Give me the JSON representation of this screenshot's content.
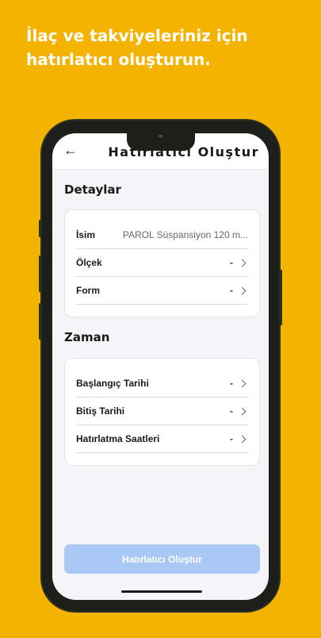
{
  "promo": {
    "headline": "İlaç ve takviyeleriniz için hatırlatıcı oluşturun."
  },
  "header": {
    "back_icon": "arrow-left-icon",
    "title": "Hatırlatıcı Oluştur"
  },
  "details": {
    "title": "Detaylar",
    "rows": [
      {
        "label": "İsim",
        "value": "PAROL Süspansiyon 120 m..."
      },
      {
        "label": "Ölçek",
        "value": "-"
      },
      {
        "label": "Form",
        "value": "-"
      }
    ]
  },
  "time": {
    "title": "Zaman",
    "rows": [
      {
        "label": "Başlangıç Tarihi",
        "value": "-"
      },
      {
        "label": "Bitiş Tarihi",
        "value": "-"
      },
      {
        "label": "Hatırlatma Saatleri",
        "value": "-"
      }
    ]
  },
  "cta": {
    "label": "Hatırlatıcı Oluştur"
  },
  "colors": {
    "background": "#F5B301",
    "cta": "#A9C8F6"
  }
}
